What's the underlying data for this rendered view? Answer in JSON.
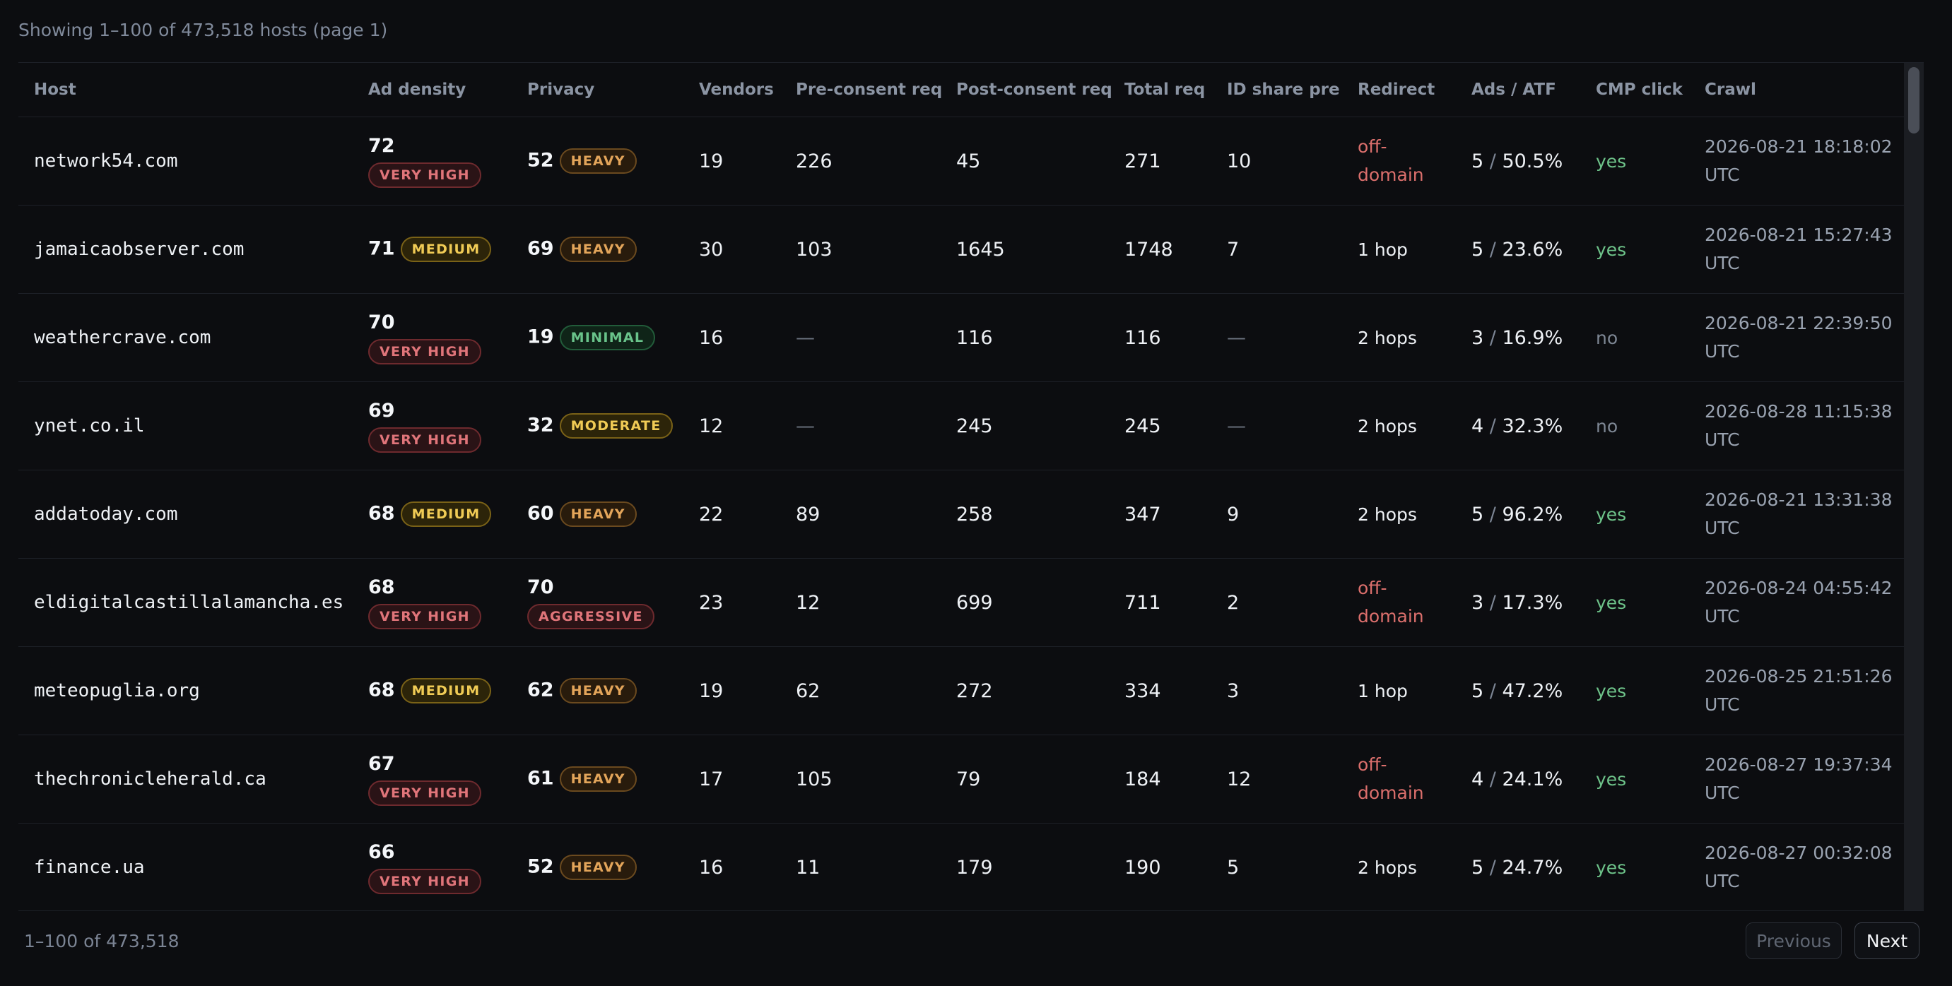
{
  "summary": "Showing 1–100 of 473,518 hosts (page 1)",
  "columns": [
    "Host",
    "Ad density",
    "Privacy",
    "Vendors",
    "Pre-consent req",
    "Post-consent req",
    "Total req",
    "ID share pre",
    "Redirect",
    "Ads / ATF",
    "CMP click",
    "Crawl"
  ],
  "rows": [
    {
      "host": "network54.com",
      "ad_score": "72",
      "ad_label": "VERY HIGH",
      "privacy_score": "52",
      "privacy_label": "HEAVY",
      "vendors": "19",
      "pre": "226",
      "post": "45",
      "total": "271",
      "id_share": "10",
      "redirect": "off-domain",
      "ads": "5",
      "atf": "50.5%",
      "cmp": "yes",
      "crawl_date": "2026-08-21 18:18:02",
      "crawl_tz": "UTC"
    },
    {
      "host": "jamaicaobserver.com",
      "ad_score": "71",
      "ad_label": "MEDIUM",
      "privacy_score": "69",
      "privacy_label": "HEAVY",
      "vendors": "30",
      "pre": "103",
      "post": "1645",
      "total": "1748",
      "id_share": "7",
      "redirect": "1 hop",
      "ads": "5",
      "atf": "23.6%",
      "cmp": "yes",
      "crawl_date": "2026-08-21 15:27:43",
      "crawl_tz": "UTC"
    },
    {
      "host": "weathercrave.com",
      "ad_score": "70",
      "ad_label": "VERY HIGH",
      "privacy_score": "19",
      "privacy_label": "MINIMAL",
      "vendors": "16",
      "pre": "—",
      "post": "116",
      "total": "116",
      "id_share": "—",
      "redirect": "2 hops",
      "ads": "3",
      "atf": "16.9%",
      "cmp": "no",
      "crawl_date": "2026-08-21 22:39:50",
      "crawl_tz": "UTC"
    },
    {
      "host": "ynet.co.il",
      "ad_score": "69",
      "ad_label": "VERY HIGH",
      "privacy_score": "32",
      "privacy_label": "MODERATE",
      "vendors": "12",
      "pre": "—",
      "post": "245",
      "total": "245",
      "id_share": "—",
      "redirect": "2 hops",
      "ads": "4",
      "atf": "32.3%",
      "cmp": "no",
      "crawl_date": "2026-08-28 11:15:38",
      "crawl_tz": "UTC"
    },
    {
      "host": "addatoday.com",
      "ad_score": "68",
      "ad_label": "MEDIUM",
      "privacy_score": "60",
      "privacy_label": "HEAVY",
      "vendors": "22",
      "pre": "89",
      "post": "258",
      "total": "347",
      "id_share": "9",
      "redirect": "2 hops",
      "ads": "5",
      "atf": "96.2%",
      "cmp": "yes",
      "crawl_date": "2026-08-21 13:31:38",
      "crawl_tz": "UTC"
    },
    {
      "host": "eldigitalcastillalamancha.es",
      "ad_score": "68",
      "ad_label": "VERY HIGH",
      "privacy_score": "70",
      "privacy_label": "AGGRESSIVE",
      "vendors": "23",
      "pre": "12",
      "post": "699",
      "total": "711",
      "id_share": "2",
      "redirect": "off-domain",
      "ads": "3",
      "atf": "17.3%",
      "cmp": "yes",
      "crawl_date": "2026-08-24 04:55:42",
      "crawl_tz": "UTC"
    },
    {
      "host": "meteopuglia.org",
      "ad_score": "68",
      "ad_label": "MEDIUM",
      "privacy_score": "62",
      "privacy_label": "HEAVY",
      "vendors": "19",
      "pre": "62",
      "post": "272",
      "total": "334",
      "id_share": "3",
      "redirect": "1 hop",
      "ads": "5",
      "atf": "47.2%",
      "cmp": "yes",
      "crawl_date": "2026-08-25 21:51:26",
      "crawl_tz": "UTC"
    },
    {
      "host": "thechronicleherald.ca",
      "ad_score": "67",
      "ad_label": "VERY HIGH",
      "privacy_score": "61",
      "privacy_label": "HEAVY",
      "vendors": "17",
      "pre": "105",
      "post": "79",
      "total": "184",
      "id_share": "12",
      "redirect": "off-domain",
      "ads": "4",
      "atf": "24.1%",
      "cmp": "yes",
      "crawl_date": "2026-08-27 19:37:34",
      "crawl_tz": "UTC"
    },
    {
      "host": "finance.ua",
      "ad_score": "66",
      "ad_label": "VERY HIGH",
      "privacy_score": "52",
      "privacy_label": "HEAVY",
      "vendors": "16",
      "pre": "11",
      "post": "179",
      "total": "190",
      "id_share": "5",
      "redirect": "2 hops",
      "ads": "5",
      "atf": "24.7%",
      "cmp": "yes",
      "crawl_date": "2026-08-27 00:32:08",
      "crawl_tz": "UTC"
    }
  ],
  "footer": {
    "range": "1–100 of 473,518",
    "previous_label": "Previous",
    "next_label": "Next"
  },
  "colors": {
    "background": "#0c0d10",
    "very_high": "#e0757a",
    "medium": "#f0cb55",
    "heavy": "#e3a55a",
    "minimal": "#69c38a",
    "yes": "#6ec48a",
    "off_domain": "#db6f6c"
  }
}
